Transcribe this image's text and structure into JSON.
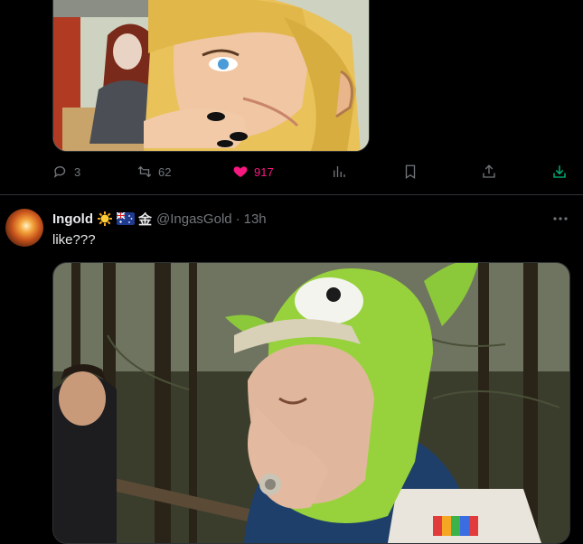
{
  "tweet1": {
    "actions": {
      "reply_count": "3",
      "retweet_count": "62",
      "like_count": "917"
    }
  },
  "tweet2": {
    "author_name": "Ingold",
    "author_badge_char": "金",
    "handle": "@IngasGold",
    "separator": "·",
    "time": "13h",
    "text": "like???"
  },
  "icons": [
    "reply-icon",
    "retweet-icon",
    "heart-icon",
    "analytics-icon",
    "bookmark-icon",
    "share-icon",
    "download-icon",
    "more-icon",
    "sun-emoji",
    "australia-flag-emoji"
  ],
  "colors": {
    "like": "#f91880",
    "muted": "#71767b",
    "text": "#e7e9ea",
    "download": "#00ba7c"
  }
}
